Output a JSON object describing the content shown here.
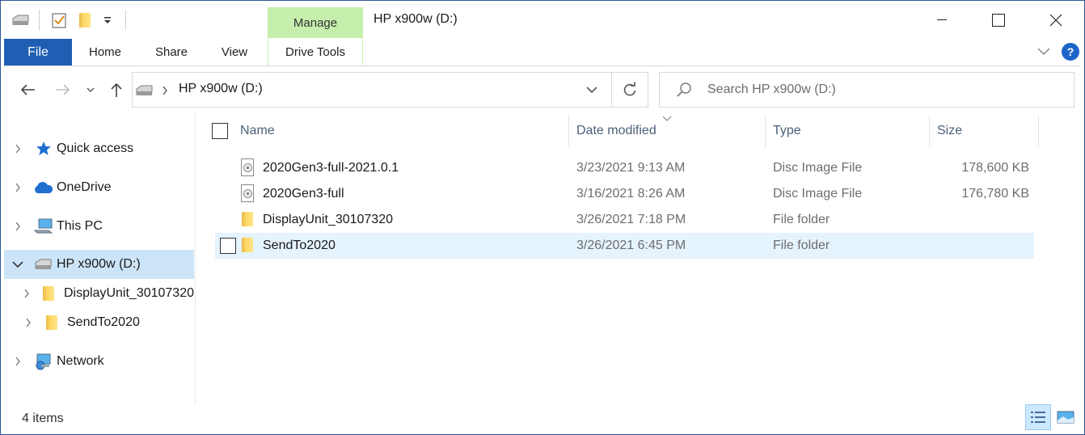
{
  "window": {
    "title": "HP x900w (D:)",
    "context_tab": "Manage"
  },
  "ribbon": {
    "tabs": [
      "File",
      "Home",
      "Share",
      "View",
      "Drive Tools"
    ],
    "help_label": "?"
  },
  "address": {
    "path": "HP x900w (D:)"
  },
  "search": {
    "placeholder": "Search HP x900w (D:)"
  },
  "sidebar": {
    "items": [
      {
        "label": "Quick access",
        "icon": "star-icon"
      },
      {
        "label": "OneDrive",
        "icon": "cloud-icon"
      },
      {
        "label": "This PC",
        "icon": "computer-icon"
      },
      {
        "label": "HP x900w (D:)",
        "icon": "drive-icon"
      },
      {
        "label": "DisplayUnit_30107320",
        "icon": "folder-icon"
      },
      {
        "label": "SendTo2020",
        "icon": "folder-icon"
      },
      {
        "label": "Network",
        "icon": "network-icon"
      }
    ]
  },
  "columns": [
    "Name",
    "Date modified",
    "Type",
    "Size"
  ],
  "files": [
    {
      "name": "2020Gen3-full-2021.0.1",
      "date": "3/23/2021 9:13 AM",
      "type": "Disc Image File",
      "size": "178,600 KB",
      "icon": "disc-image-icon"
    },
    {
      "name": "2020Gen3-full",
      "date": "3/16/2021 8:26 AM",
      "type": "Disc Image File",
      "size": "176,780 KB",
      "icon": "disc-image-icon"
    },
    {
      "name": "DisplayUnit_30107320",
      "date": "3/26/2021 7:18 PM",
      "type": "File folder",
      "size": "",
      "icon": "folder-icon"
    },
    {
      "name": "SendTo2020",
      "date": "3/26/2021 6:45 PM",
      "type": "File folder",
      "size": "",
      "icon": "folder-icon"
    }
  ],
  "status": {
    "item_count": "4 items"
  },
  "colors": {
    "file_tab": "#1e5fb4",
    "manage_tab": "#c6efad",
    "selected": "#cce4f7",
    "hover_row": "#e5f3ff"
  }
}
